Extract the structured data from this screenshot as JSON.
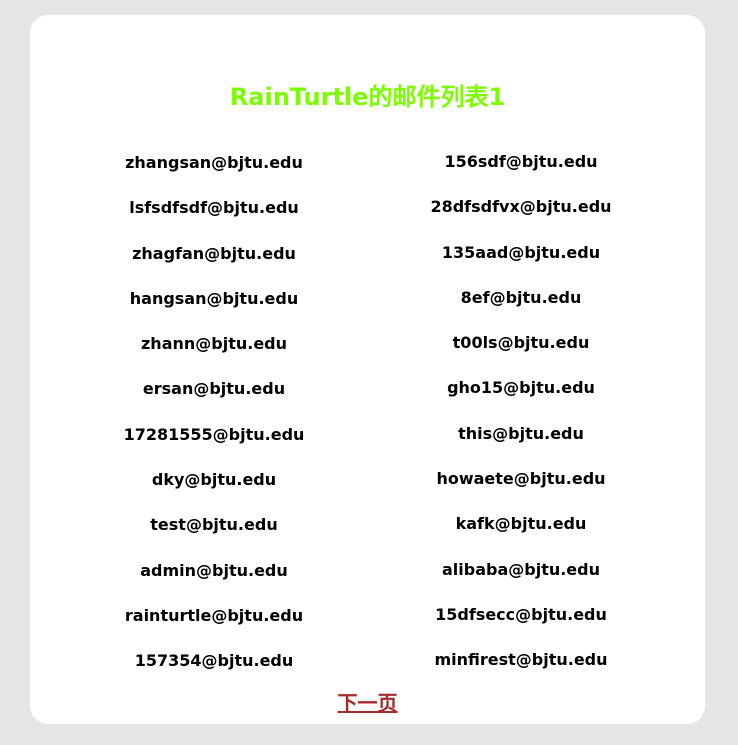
{
  "title": "RainTurtle的邮件列表1",
  "colors": {
    "title": "#7cfc00",
    "link": "#a52a2a",
    "background": "#e5e5e5",
    "card": "#ffffff"
  },
  "emails_left": [
    "zhangsan@bjtu.edu",
    "lsfsdfsdf@bjtu.edu",
    "zhagfan@bjtu.edu",
    "hangsan@bjtu.edu",
    "zhann@bjtu.edu",
    "ersan@bjtu.edu",
    "17281555@bjtu.edu",
    "dky@bjtu.edu",
    "test@bjtu.edu",
    "admin@bjtu.edu",
    "rainturtle@bjtu.edu",
    "157354@bjtu.edu"
  ],
  "emails_right": [
    "156sdf@bjtu.edu",
    "28dfsdfvx@bjtu.edu",
    "135aad@bjtu.edu",
    "8ef@bjtu.edu",
    "t00ls@bjtu.edu",
    "gho15@bjtu.edu",
    "this@bjtu.edu",
    "howaete@bjtu.edu",
    "kafk@bjtu.edu",
    "alibaba@bjtu.edu",
    "15dfsecc@bjtu.edu",
    "minfirest@bjtu.edu"
  ],
  "next_link": "下一页"
}
